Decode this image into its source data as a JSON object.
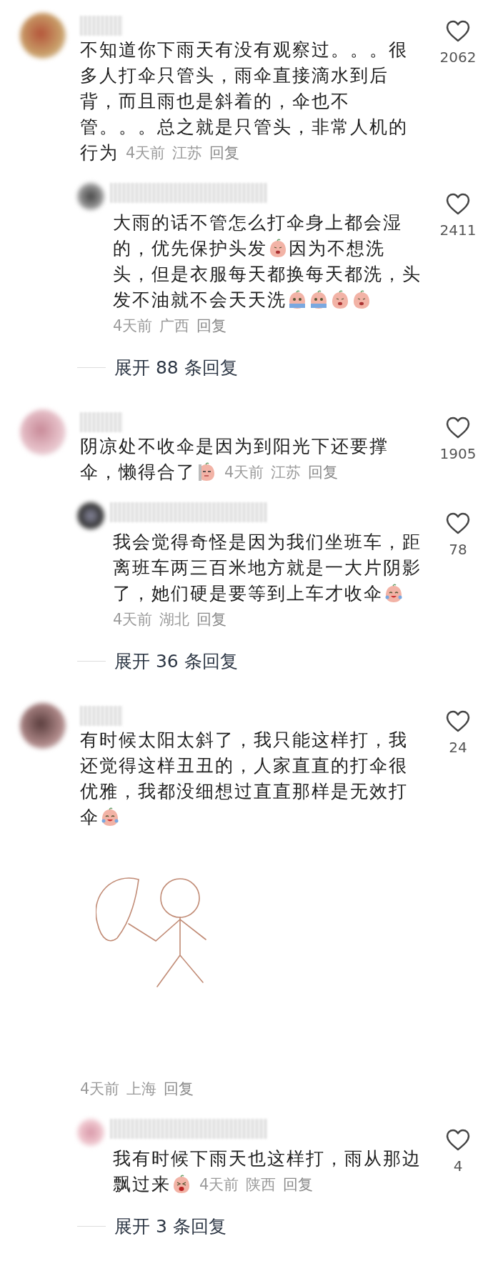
{
  "comments": [
    {
      "lines": [
        [
          {
            "kind": "text",
            "text": "不知道你下雨天有没有观察过。。。很"
          }
        ],
        [
          {
            "kind": "text",
            "text": "多人打伞只管头，雨伞直接滴水到后"
          }
        ],
        [
          {
            "kind": "text",
            "text": "背，而且雨也是斜着的，伞也不"
          }
        ],
        [
          {
            "kind": "text",
            "text": "管。。。总之就是只管头，非常人机的"
          }
        ],
        [
          {
            "kind": "text",
            "text": "行为"
          },
          {
            "kind": "meta",
            "time": "4天前",
            "location": "江苏",
            "reply": "回复"
          }
        ]
      ],
      "likes": "2062",
      "replies": [
        {
          "lines": [
            [
              {
                "kind": "text",
                "text": "大雨的话不管怎么打伞身上都会湿"
              }
            ],
            [
              {
                "kind": "text",
                "text": "的，优先保护头发"
              },
              {
                "kind": "sticker"
              },
              {
                "kind": "text",
                "text": "因为不想洗"
              }
            ],
            [
              {
                "kind": "text",
                "text": "头，但是衣服每天都换每天都洗，头"
              }
            ],
            [
              {
                "kind": "text",
                "text": "发不油就不会天天洗"
              },
              {
                "kind": "sticker"
              },
              {
                "kind": "sticker"
              },
              {
                "kind": "sticker"
              },
              {
                "kind": "sticker"
              }
            ],
            [
              {
                "kind": "meta",
                "time": "4天前",
                "location": "广西",
                "reply": "回复"
              }
            ]
          ],
          "likes": "2411"
        }
      ],
      "expand": "展开 88 条回复"
    },
    {
      "lines": [
        [
          {
            "kind": "text",
            "text": "阴凉处不收伞是因为到阳光下还要撑"
          }
        ],
        [
          {
            "kind": "text",
            "text": "伞，懒得合了"
          },
          {
            "kind": "sticker"
          },
          {
            "kind": "meta",
            "time": "4天前",
            "location": "江苏",
            "reply": "回复"
          }
        ]
      ],
      "likes": "1905",
      "replies": [
        {
          "lines": [
            [
              {
                "kind": "text",
                "text": "我会觉得奇怪是因为我们坐班车，距"
              }
            ],
            [
              {
                "kind": "text",
                "text": "离班车两三百米地方就是一大片阴影"
              }
            ],
            [
              {
                "kind": "text",
                "text": "了，她们硬是要等到上车才收伞"
              },
              {
                "kind": "sticker"
              }
            ],
            [
              {
                "kind": "meta",
                "time": "4天前",
                "location": "湖北",
                "reply": "回复"
              }
            ]
          ],
          "likes": "78"
        }
      ],
      "expand": "展开 36 条回复"
    },
    {
      "lines": [
        [
          {
            "kind": "text",
            "text": "有时候太阳太斜了，我只能这样打，我"
          }
        ],
        [
          {
            "kind": "text",
            "text": "还觉得这样丑丑的，人家直直的打伞很"
          }
        ],
        [
          {
            "kind": "text",
            "text": "优雅，我都没细想过直直那样是无效打"
          }
        ],
        [
          {
            "kind": "text",
            "text": "伞"
          },
          {
            "kind": "sticker"
          }
        ],
        [
          {
            "kind": "sketch"
          }
        ],
        [
          {
            "kind": "meta",
            "time": "4天前",
            "location": "上海",
            "reply": "回复"
          }
        ]
      ],
      "likes": "24",
      "replies": [
        {
          "lines": [
            [
              {
                "kind": "text",
                "text": "我有时候下雨天也这样打，雨从那边"
              }
            ],
            [
              {
                "kind": "text",
                "text": "飘过来"
              },
              {
                "kind": "sticker"
              },
              {
                "kind": "meta",
                "time": "4天前",
                "location": "陕西",
                "reply": "回复"
              }
            ]
          ],
          "likes": "4"
        }
      ],
      "expand": "展开 3 条回复"
    }
  ]
}
